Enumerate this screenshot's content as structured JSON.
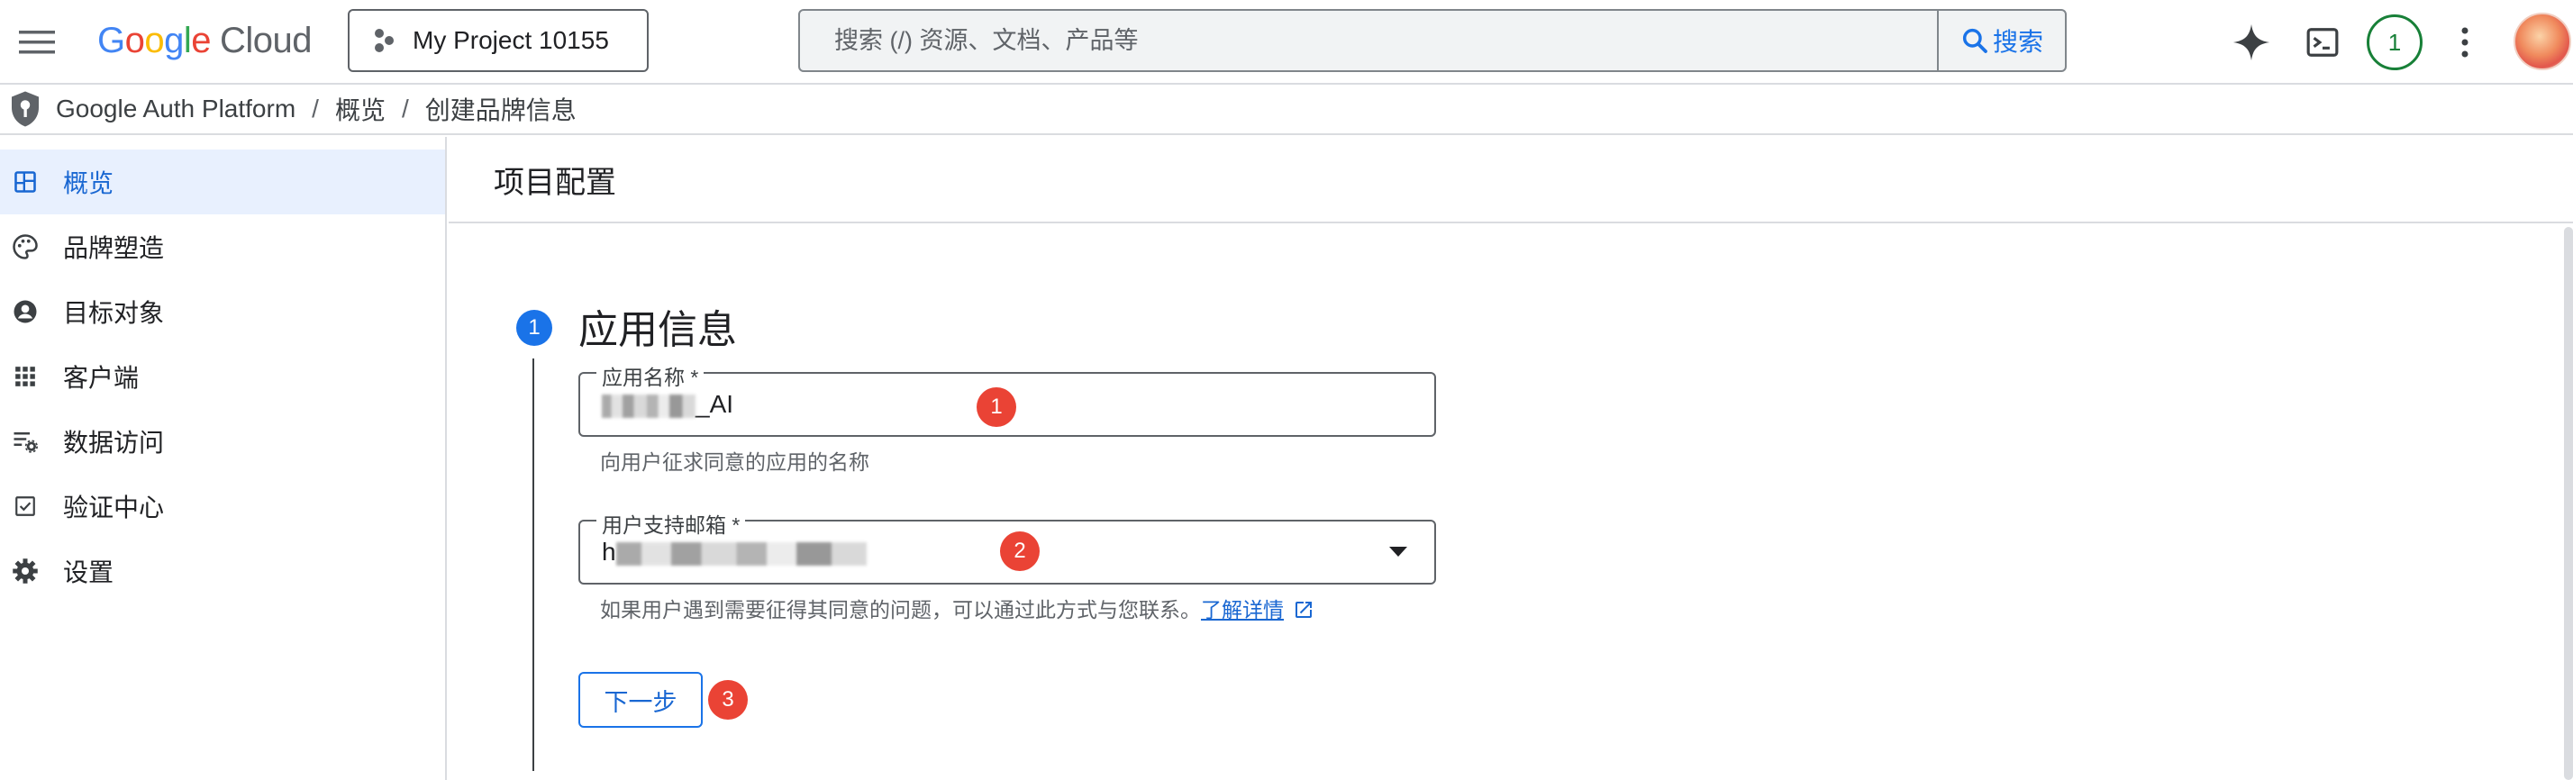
{
  "topbar": {
    "logo_google": "Google",
    "logo_cloud": "Cloud",
    "project_name": "My Project 10155",
    "search_placeholder": "搜索 (/) 资源、文档、产品等",
    "search_button": "搜索",
    "notification_count": "1",
    "logo_colors": [
      "#4285F4",
      "#EA4335",
      "#FBBC05",
      "#4285F4",
      "#34A853",
      "#EA4335"
    ]
  },
  "breadcrumb": {
    "items": [
      "Google Auth Platform",
      "概览",
      "创建品牌信息"
    ],
    "separator": "/"
  },
  "sidebar": {
    "items": [
      {
        "label": "概览",
        "icon": "dashboard-icon",
        "active": true
      },
      {
        "label": "品牌塑造",
        "icon": "palette-icon",
        "active": false
      },
      {
        "label": "目标对象",
        "icon": "account-circle-icon",
        "active": false
      },
      {
        "label": "客户端",
        "icon": "apps-grid-icon",
        "active": false
      },
      {
        "label": "数据访问",
        "icon": "data-settings-icon",
        "active": false
      },
      {
        "label": "验证中心",
        "icon": "checkbox-icon",
        "active": false
      },
      {
        "label": "设置",
        "icon": "gear-icon",
        "active": false
      }
    ]
  },
  "main": {
    "page_title": "项目配置",
    "step_number": "1",
    "step_title": "应用信息",
    "app_name": {
      "label": "应用名称 *",
      "value_suffix": "_AI",
      "helper": "向用户征求同意的应用的名称"
    },
    "support_email": {
      "label": "用户支持邮箱 *",
      "value_prefix": "h",
      "helper": "如果用户遇到需要征得其同意的问题，可以通过此方式与您联系。",
      "learn_more": "了解详情"
    },
    "next_button": "下一步",
    "markers": [
      "1",
      "2",
      "3"
    ]
  },
  "colors": {
    "accent": "#1a73e8",
    "active_nav_bg": "#e8f0fe",
    "marker": "#ea4335",
    "notification": "#188038"
  }
}
